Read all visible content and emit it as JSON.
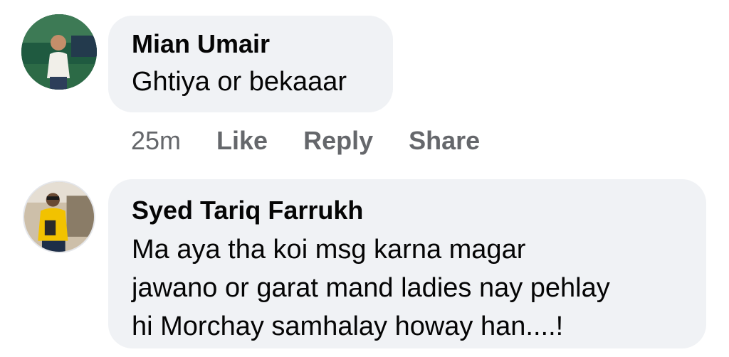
{
  "comments": [
    {
      "author": "Mian Umair",
      "lines": [
        "Ghtiya or bekaaar"
      ],
      "actions": {
        "time": "25m",
        "like": "Like",
        "reply": "Reply",
        "share": "Share"
      }
    },
    {
      "author": "Syed Tariq Farrukh",
      "lines": [
        "Ma aya tha koi msg karna magar",
        "jawano or garat mand ladies nay pehlay",
        "hi Morchay samhalay howay han....!"
      ]
    }
  ],
  "colors": {
    "bubble": "#f0f2f5",
    "text": "#050505",
    "secondary_text": "#65676b"
  },
  "icons": [
    "profile-photo-mian-umair",
    "profile-photo-syed-tariq-farrukh"
  ]
}
